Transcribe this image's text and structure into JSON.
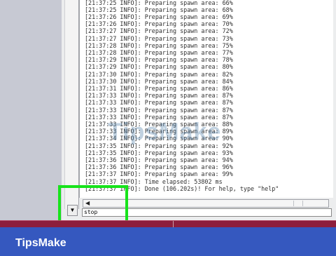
{
  "brand": "TipsMake",
  "watermark": "TipsMake",
  "command_input": {
    "value": "stop"
  },
  "log_lines": [
    "[21:37:25 INFO]: Preparing spawn area: 66%",
    "[21:37:25 INFO]: Preparing spawn area: 68%",
    "[21:37:26 INFO]: Preparing spawn area: 69%",
    "[21:37:26 INFO]: Preparing spawn area: 70%",
    "[21:37:27 INFO]: Preparing spawn area: 72%",
    "[21:37:27 INFO]: Preparing spawn area: 73%",
    "[21:37:28 INFO]: Preparing spawn area: 75%",
    "[21:37:28 INFO]: Preparing spawn area: 77%",
    "[21:37:29 INFO]: Preparing spawn area: 78%",
    "[21:37:29 INFO]: Preparing spawn area: 80%",
    "[21:37:30 INFO]: Preparing spawn area: 82%",
    "[21:37:30 INFO]: Preparing spawn area: 84%",
    "[21:37:31 INFO]: Preparing spawn area: 86%",
    "[21:37:33 INFO]: Preparing spawn area: 87%",
    "[21:37:33 INFO]: Preparing spawn area: 87%",
    "[21:37:33 INFO]: Preparing spawn area: 87%",
    "[21:37:33 INFO]: Preparing spawn area: 87%",
    "[21:37:33 INFO]: Preparing spawn area: 88%",
    "[21:37:33 INFO]: Preparing spawn area: 89%",
    "[21:37:34 INFO]: Preparing spawn area: 90%",
    "[21:37:35 INFO]: Preparing spawn area: 92%",
    "[21:37:35 INFO]: Preparing spawn area: 93%",
    "[21:37:36 INFO]: Preparing spawn area: 94%",
    "[21:37:36 INFO]: Preparing spawn area: 96%",
    "[21:37:37 INFO]: Preparing spawn area: 99%",
    "[21:37:37 INFO]: Time elapsed: 53802 ms",
    "[21:37:37 INFO]: Done (106.202s)! For help, type \"help\""
  ],
  "colors": {
    "background": "#3558bf",
    "highlight": "#17e31b",
    "taskbar": "#8d1e3c"
  },
  "icons": {
    "scroll_down": "triangle-down",
    "scroll_left": "triangle-left"
  }
}
